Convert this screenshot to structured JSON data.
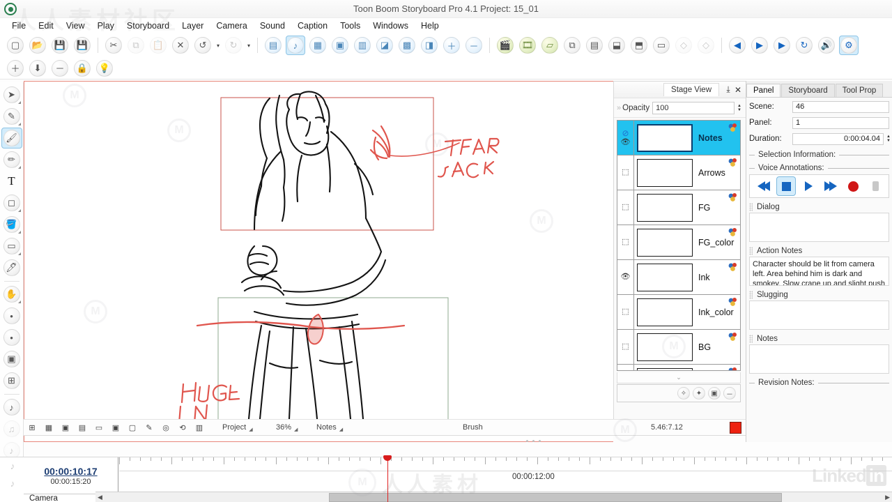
{
  "titlebar": {
    "title": "Toon Boom Storyboard Pro 4.1 Project: 15_01",
    "logo_icon": "app-logo-icon"
  },
  "menubar": {
    "items": [
      {
        "label": "File"
      },
      {
        "label": "Edit"
      },
      {
        "label": "View"
      },
      {
        "label": "Play"
      },
      {
        "label": "Storyboard"
      },
      {
        "label": "Layer"
      },
      {
        "label": "Camera"
      },
      {
        "label": "Sound"
      },
      {
        "label": "Caption"
      },
      {
        "label": "Tools"
      },
      {
        "label": "Windows"
      },
      {
        "label": "Help"
      }
    ]
  },
  "toolbar_row1": [
    {
      "name": "new-project-icon",
      "glyph": "▢",
      "state": "normal"
    },
    {
      "name": "open-project-icon",
      "glyph": "📂",
      "state": "normal"
    },
    {
      "name": "save-icon",
      "glyph": "💾",
      "state": "normal"
    },
    {
      "name": "save-as-icon",
      "glyph": "💾",
      "state": "normal"
    },
    {
      "name": "separator",
      "glyph": "",
      "state": "sep"
    },
    {
      "name": "cut-icon",
      "glyph": "✂",
      "state": "normal"
    },
    {
      "name": "copy-icon",
      "glyph": "⧉",
      "state": "dim"
    },
    {
      "name": "paste-icon",
      "glyph": "📋",
      "state": "dim"
    },
    {
      "name": "delete-icon",
      "glyph": "✕",
      "state": "normal"
    },
    {
      "name": "undo-icon",
      "glyph": "↺",
      "state": "normal"
    },
    {
      "name": "undo-dropdown-icon",
      "glyph": "▾",
      "state": "drop"
    },
    {
      "name": "redo-icon",
      "glyph": "↻",
      "state": "dim"
    },
    {
      "name": "redo-dropdown-icon",
      "glyph": "▾",
      "state": "drop"
    },
    {
      "name": "separator",
      "glyph": "",
      "state": "sep"
    },
    {
      "name": "caption-view-icon",
      "glyph": "▤",
      "state": "normal"
    },
    {
      "name": "stage-view-icon",
      "glyph": "♪",
      "state": "selected"
    },
    {
      "name": "thumbnails-view-icon",
      "glyph": "▦",
      "state": "normal"
    },
    {
      "name": "panel-view-icon",
      "glyph": "▣",
      "state": "normal"
    },
    {
      "name": "vertical-workspace-icon",
      "glyph": "▥",
      "state": "normal"
    },
    {
      "name": "horizontal-workspace-icon",
      "glyph": "◪",
      "state": "normal"
    },
    {
      "name": "timeline-view-icon",
      "glyph": "▩",
      "state": "normal"
    },
    {
      "name": "library-view-icon",
      "glyph": "◨",
      "state": "normal"
    },
    {
      "name": "zoom-in-icon",
      "glyph": "＋",
      "state": "normal"
    },
    {
      "name": "zoom-out-icon",
      "glyph": "－",
      "state": "normal"
    },
    {
      "name": "separator",
      "glyph": "",
      "state": "sep"
    },
    {
      "name": "new-scene-icon",
      "glyph": "🎬",
      "state": "normal"
    },
    {
      "name": "new-sequence-icon",
      "glyph": "🎞",
      "state": "normal"
    },
    {
      "name": "new-panel-icon",
      "glyph": "▱",
      "state": "normal"
    },
    {
      "name": "duplicate-panel-icon",
      "glyph": "⧉",
      "state": "normal"
    },
    {
      "name": "import-images-icon",
      "glyph": "▤",
      "state": "normal"
    },
    {
      "name": "split-scene-icon",
      "glyph": "⬓",
      "state": "normal"
    },
    {
      "name": "split-panel-icon",
      "glyph": "⬒",
      "state": "normal"
    },
    {
      "name": "merge-panel-icon",
      "glyph": "▭",
      "state": "normal"
    },
    {
      "name": "add-transition-icon",
      "glyph": "◇",
      "state": "dim"
    },
    {
      "name": "remove-transition-icon",
      "glyph": "◇",
      "state": "dim"
    },
    {
      "name": "separator",
      "glyph": "",
      "state": "sep"
    },
    {
      "name": "previous-panel-icon",
      "glyph": "◀",
      "state": "normal"
    },
    {
      "name": "next-panel-icon",
      "glyph": "▶",
      "state": "normal"
    },
    {
      "name": "play-icon",
      "glyph": "▶",
      "state": "normal"
    },
    {
      "name": "loop-icon",
      "glyph": "↻",
      "state": "normal"
    },
    {
      "name": "sound-toggle-icon",
      "glyph": "🔊",
      "state": "normal"
    },
    {
      "name": "render-icon",
      "glyph": "⚙",
      "state": "selected"
    }
  ],
  "toolbar_row2": [
    {
      "name": "add-layer-icon",
      "glyph": "＋"
    },
    {
      "name": "import-layer-icon",
      "glyph": "⬇"
    },
    {
      "name": "delete-layer-icon",
      "glyph": "－"
    },
    {
      "name": "lock-layer-icon",
      "glyph": "🔒"
    },
    {
      "name": "light-table-icon",
      "glyph": "💡"
    }
  ],
  "left_toolbar": [
    {
      "name": "select-tool",
      "glyph": "➤",
      "state": "normal",
      "corner": true
    },
    {
      "name": "cutter-tool",
      "glyph": "✎",
      "state": "normal",
      "corner": true
    },
    {
      "name": "brush-tool",
      "glyph": "🖌",
      "state": "selected",
      "corner": false
    },
    {
      "name": "pencil-tool",
      "glyph": "✏",
      "state": "normal",
      "corner": true
    },
    {
      "name": "text-tool",
      "glyph": "T",
      "state": "normal",
      "corner": false
    },
    {
      "name": "eraser-tool",
      "glyph": "◻",
      "state": "normal",
      "corner": true
    },
    {
      "name": "paint-bucket-tool",
      "glyph": "🪣",
      "state": "normal",
      "corner": true
    },
    {
      "name": "shape-rectangle-tool",
      "glyph": "▭",
      "state": "normal",
      "corner": true
    },
    {
      "name": "dropper-tool",
      "glyph": "🖊",
      "state": "normal",
      "corner": false
    },
    {
      "name": "separator",
      "glyph": "",
      "state": "sep",
      "corner": false
    },
    {
      "name": "hand-tool",
      "glyph": "✋",
      "state": "normal",
      "corner": true
    },
    {
      "name": "camera-start-tool",
      "glyph": "•",
      "state": "normal",
      "corner": false
    },
    {
      "name": "camera-end-tool",
      "glyph": "•",
      "state": "normal",
      "corner": false
    },
    {
      "name": "camera-keyframe-tool",
      "glyph": "▣",
      "state": "normal",
      "corner": false
    },
    {
      "name": "camera-frame-tool",
      "glyph": "⊞",
      "state": "normal",
      "corner": false
    },
    {
      "name": "separator",
      "glyph": "",
      "state": "sep",
      "corner": false
    },
    {
      "name": "add-sound-tool",
      "glyph": "♪",
      "state": "normal",
      "corner": false
    },
    {
      "name": "edit-sound-tool",
      "glyph": "♫",
      "state": "dim",
      "corner": false
    },
    {
      "name": "sound-note-tool",
      "glyph": "♪",
      "state": "dim",
      "corner": false
    },
    {
      "name": "sound-note2-tool",
      "glyph": "♪",
      "state": "dim",
      "corner": false
    }
  ],
  "stage": {
    "status_icons": [
      {
        "name": "safe-area-icon",
        "glyph": "⊞"
      },
      {
        "name": "grid-icon",
        "glyph": "▦"
      },
      {
        "name": "camera-mask-icon",
        "glyph": "▣"
      },
      {
        "name": "title-safe-icon",
        "glyph": "▤"
      },
      {
        "name": "aspect-ratio-icon",
        "glyph": "▭"
      },
      {
        "name": "full-frame-icon",
        "glyph": "▣"
      },
      {
        "name": "camera-view-icon",
        "glyph": "▢"
      },
      {
        "name": "light-table-icon",
        "glyph": "✎"
      },
      {
        "name": "onion-skin-icon",
        "glyph": "◎"
      },
      {
        "name": "flip-icon",
        "glyph": "⟲"
      },
      {
        "name": "reference-icon",
        "glyph": "▥"
      }
    ],
    "project_label": "Project",
    "zoom_label": "36%",
    "layer_label": "Notes",
    "tool_label": "Brush",
    "coords_label": "5.46:7.12",
    "swatch_color": "#ee2211"
  },
  "layers_panel": {
    "tab_label": "Stage View",
    "float_icon": "float-window-icon",
    "close_icon": "close-icon",
    "opacity_label": "Opacity",
    "opacity_value": "100",
    "layers": [
      {
        "name": "Notes",
        "selected": true,
        "visible": true,
        "locked": true
      },
      {
        "name": "Arrows",
        "selected": false,
        "visible": false,
        "locked": false
      },
      {
        "name": "FG",
        "selected": false,
        "visible": false,
        "locked": false
      },
      {
        "name": "FG_color",
        "selected": false,
        "visible": false,
        "locked": false
      },
      {
        "name": "Ink",
        "selected": false,
        "visible": true,
        "locked": false
      },
      {
        "name": "Ink_color",
        "selected": false,
        "visible": false,
        "locked": false
      },
      {
        "name": "BG",
        "selected": false,
        "visible": false,
        "locked": false
      },
      {
        "name": "",
        "selected": false,
        "visible": false,
        "locked": false
      }
    ],
    "tool_icons": [
      {
        "name": "add-vector-layer-icon",
        "glyph": "✧"
      },
      {
        "name": "add-bitmap-layer-icon",
        "glyph": "✦"
      },
      {
        "name": "add-3d-layer-icon",
        "glyph": "▣"
      },
      {
        "name": "delete-layer-icon",
        "glyph": "－"
      }
    ]
  },
  "right_panel": {
    "tabs": [
      {
        "label": "Panel",
        "active": true
      },
      {
        "label": "Storyboard",
        "active": false
      },
      {
        "label": "Tool Prop",
        "active": false
      }
    ],
    "scene_label": "Scene:",
    "scene_value": "46",
    "panel_label": "Panel:",
    "panel_value": "1",
    "duration_label": "Duration:",
    "duration_value": "0:00:04.04",
    "selection_information_label": "Selection Information:",
    "voice_annotations_label": "Voice Annotations:",
    "voice_buttons": [
      {
        "name": "rewind-button",
        "glyph": "◀◀",
        "selected": false
      },
      {
        "name": "stop-button",
        "glyph": "■",
        "selected": true
      },
      {
        "name": "play-button",
        "glyph": "▶",
        "selected": false
      },
      {
        "name": "fast-forward-button",
        "glyph": "▶▶",
        "selected": false
      },
      {
        "name": "record-button",
        "glyph": "●",
        "selected": false
      },
      {
        "name": "more-button",
        "glyph": "▸",
        "selected": false
      }
    ],
    "dialog_label": "Dialog",
    "dialog_text": "",
    "action_notes_label": "Action Notes",
    "action_notes_text": "Character should be lit from camera left. Area behind him is dark and smokey. Slow crane up and slight push in and up.",
    "slugging_label": "Slugging",
    "slugging_text": "",
    "notes_label": "Notes",
    "notes_text": "",
    "revision_notes_label": "Revision Notes:"
  },
  "timeline": {
    "current_time": "00:00:10:17",
    "total_time": "00:00:15:20",
    "track_label": "Camera",
    "ruler_timecode": "00:00:12:00"
  },
  "canvas_annotations": {
    "note_tear": "TEAR\nJACK",
    "note_huge": "HUGE\nIN\nPANTS"
  },
  "watermarks": {
    "chinese": "人人素材社区",
    "brand": "人人素材",
    "linkedin_a": "Linked",
    "linkedin_b": "in"
  }
}
